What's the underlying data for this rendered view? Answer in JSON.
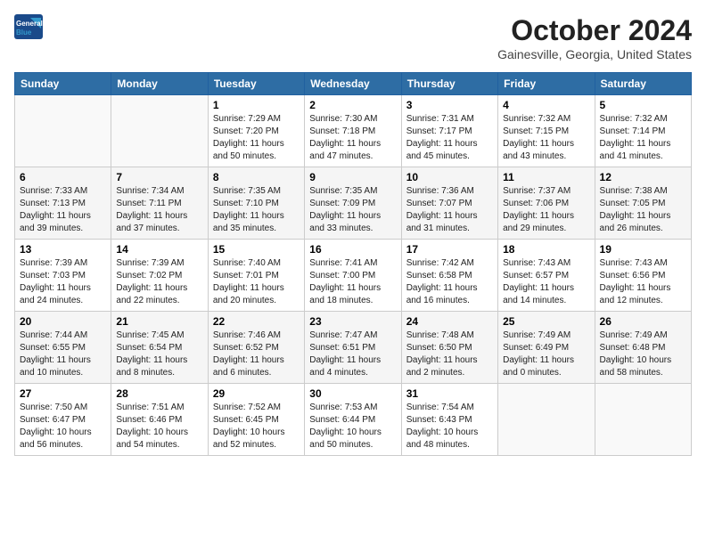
{
  "header": {
    "logo_line1": "General",
    "logo_line2": "Blue",
    "month": "October 2024",
    "location": "Gainesville, Georgia, United States"
  },
  "days_of_week": [
    "Sunday",
    "Monday",
    "Tuesday",
    "Wednesday",
    "Thursday",
    "Friday",
    "Saturday"
  ],
  "weeks": [
    [
      {
        "day": "",
        "sunrise": "",
        "sunset": "",
        "daylight": ""
      },
      {
        "day": "",
        "sunrise": "",
        "sunset": "",
        "daylight": ""
      },
      {
        "day": "1",
        "sunrise": "Sunrise: 7:29 AM",
        "sunset": "Sunset: 7:20 PM",
        "daylight": "Daylight: 11 hours and 50 minutes."
      },
      {
        "day": "2",
        "sunrise": "Sunrise: 7:30 AM",
        "sunset": "Sunset: 7:18 PM",
        "daylight": "Daylight: 11 hours and 47 minutes."
      },
      {
        "day": "3",
        "sunrise": "Sunrise: 7:31 AM",
        "sunset": "Sunset: 7:17 PM",
        "daylight": "Daylight: 11 hours and 45 minutes."
      },
      {
        "day": "4",
        "sunrise": "Sunrise: 7:32 AM",
        "sunset": "Sunset: 7:15 PM",
        "daylight": "Daylight: 11 hours and 43 minutes."
      },
      {
        "day": "5",
        "sunrise": "Sunrise: 7:32 AM",
        "sunset": "Sunset: 7:14 PM",
        "daylight": "Daylight: 11 hours and 41 minutes."
      }
    ],
    [
      {
        "day": "6",
        "sunrise": "Sunrise: 7:33 AM",
        "sunset": "Sunset: 7:13 PM",
        "daylight": "Daylight: 11 hours and 39 minutes."
      },
      {
        "day": "7",
        "sunrise": "Sunrise: 7:34 AM",
        "sunset": "Sunset: 7:11 PM",
        "daylight": "Daylight: 11 hours and 37 minutes."
      },
      {
        "day": "8",
        "sunrise": "Sunrise: 7:35 AM",
        "sunset": "Sunset: 7:10 PM",
        "daylight": "Daylight: 11 hours and 35 minutes."
      },
      {
        "day": "9",
        "sunrise": "Sunrise: 7:35 AM",
        "sunset": "Sunset: 7:09 PM",
        "daylight": "Daylight: 11 hours and 33 minutes."
      },
      {
        "day": "10",
        "sunrise": "Sunrise: 7:36 AM",
        "sunset": "Sunset: 7:07 PM",
        "daylight": "Daylight: 11 hours and 31 minutes."
      },
      {
        "day": "11",
        "sunrise": "Sunrise: 7:37 AM",
        "sunset": "Sunset: 7:06 PM",
        "daylight": "Daylight: 11 hours and 29 minutes."
      },
      {
        "day": "12",
        "sunrise": "Sunrise: 7:38 AM",
        "sunset": "Sunset: 7:05 PM",
        "daylight": "Daylight: 11 hours and 26 minutes."
      }
    ],
    [
      {
        "day": "13",
        "sunrise": "Sunrise: 7:39 AM",
        "sunset": "Sunset: 7:03 PM",
        "daylight": "Daylight: 11 hours and 24 minutes."
      },
      {
        "day": "14",
        "sunrise": "Sunrise: 7:39 AM",
        "sunset": "Sunset: 7:02 PM",
        "daylight": "Daylight: 11 hours and 22 minutes."
      },
      {
        "day": "15",
        "sunrise": "Sunrise: 7:40 AM",
        "sunset": "Sunset: 7:01 PM",
        "daylight": "Daylight: 11 hours and 20 minutes."
      },
      {
        "day": "16",
        "sunrise": "Sunrise: 7:41 AM",
        "sunset": "Sunset: 7:00 PM",
        "daylight": "Daylight: 11 hours and 18 minutes."
      },
      {
        "day": "17",
        "sunrise": "Sunrise: 7:42 AM",
        "sunset": "Sunset: 6:58 PM",
        "daylight": "Daylight: 11 hours and 16 minutes."
      },
      {
        "day": "18",
        "sunrise": "Sunrise: 7:43 AM",
        "sunset": "Sunset: 6:57 PM",
        "daylight": "Daylight: 11 hours and 14 minutes."
      },
      {
        "day": "19",
        "sunrise": "Sunrise: 7:43 AM",
        "sunset": "Sunset: 6:56 PM",
        "daylight": "Daylight: 11 hours and 12 minutes."
      }
    ],
    [
      {
        "day": "20",
        "sunrise": "Sunrise: 7:44 AM",
        "sunset": "Sunset: 6:55 PM",
        "daylight": "Daylight: 11 hours and 10 minutes."
      },
      {
        "day": "21",
        "sunrise": "Sunrise: 7:45 AM",
        "sunset": "Sunset: 6:54 PM",
        "daylight": "Daylight: 11 hours and 8 minutes."
      },
      {
        "day": "22",
        "sunrise": "Sunrise: 7:46 AM",
        "sunset": "Sunset: 6:52 PM",
        "daylight": "Daylight: 11 hours and 6 minutes."
      },
      {
        "day": "23",
        "sunrise": "Sunrise: 7:47 AM",
        "sunset": "Sunset: 6:51 PM",
        "daylight": "Daylight: 11 hours and 4 minutes."
      },
      {
        "day": "24",
        "sunrise": "Sunrise: 7:48 AM",
        "sunset": "Sunset: 6:50 PM",
        "daylight": "Daylight: 11 hours and 2 minutes."
      },
      {
        "day": "25",
        "sunrise": "Sunrise: 7:49 AM",
        "sunset": "Sunset: 6:49 PM",
        "daylight": "Daylight: 11 hours and 0 minutes."
      },
      {
        "day": "26",
        "sunrise": "Sunrise: 7:49 AM",
        "sunset": "Sunset: 6:48 PM",
        "daylight": "Daylight: 10 hours and 58 minutes."
      }
    ],
    [
      {
        "day": "27",
        "sunrise": "Sunrise: 7:50 AM",
        "sunset": "Sunset: 6:47 PM",
        "daylight": "Daylight: 10 hours and 56 minutes."
      },
      {
        "day": "28",
        "sunrise": "Sunrise: 7:51 AM",
        "sunset": "Sunset: 6:46 PM",
        "daylight": "Daylight: 10 hours and 54 minutes."
      },
      {
        "day": "29",
        "sunrise": "Sunrise: 7:52 AM",
        "sunset": "Sunset: 6:45 PM",
        "daylight": "Daylight: 10 hours and 52 minutes."
      },
      {
        "day": "30",
        "sunrise": "Sunrise: 7:53 AM",
        "sunset": "Sunset: 6:44 PM",
        "daylight": "Daylight: 10 hours and 50 minutes."
      },
      {
        "day": "31",
        "sunrise": "Sunrise: 7:54 AM",
        "sunset": "Sunset: 6:43 PM",
        "daylight": "Daylight: 10 hours and 48 minutes."
      },
      {
        "day": "",
        "sunrise": "",
        "sunset": "",
        "daylight": ""
      },
      {
        "day": "",
        "sunrise": "",
        "sunset": "",
        "daylight": ""
      }
    ]
  ]
}
